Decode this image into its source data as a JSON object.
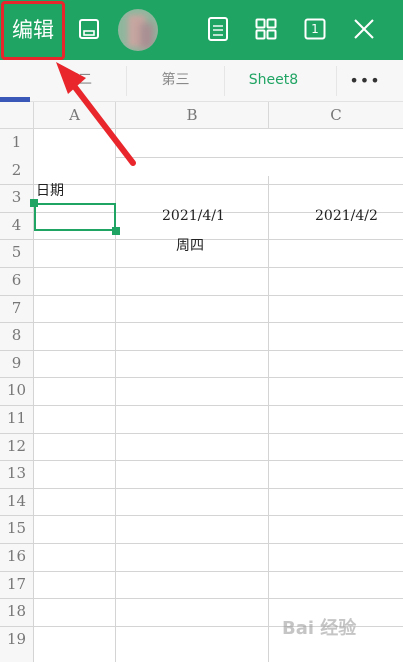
{
  "toolbar": {
    "edit_label": "编辑",
    "icons": [
      "save-icon",
      "avatar",
      "file-info-icon",
      "grid-view-icon",
      "page-count-icon",
      "close-icon"
    ],
    "page_count": "1",
    "accent_color": "#1fa463"
  },
  "tabs": [
    {
      "label": "第二",
      "active": false
    },
    {
      "label": "第三",
      "active": false
    },
    {
      "label": "Sheet8",
      "active": true
    },
    {
      "label": "•••",
      "active": false
    }
  ],
  "columns": [
    "A",
    "B",
    "C"
  ],
  "rows": [
    "1",
    "2",
    "3",
    "4",
    "5",
    "6",
    "7",
    "8",
    "9",
    "10",
    "11",
    "12",
    "13",
    "14",
    "15",
    "16",
    "17",
    "18",
    "19"
  ],
  "cells": {
    "A2": "日期",
    "B3": "2021/4/1",
    "C3": "2021/4/2",
    "B4": "周四"
  },
  "selected_cell": "A3",
  "annotation": {
    "color": "#e8262b"
  },
  "watermark": "Bai 经验"
}
